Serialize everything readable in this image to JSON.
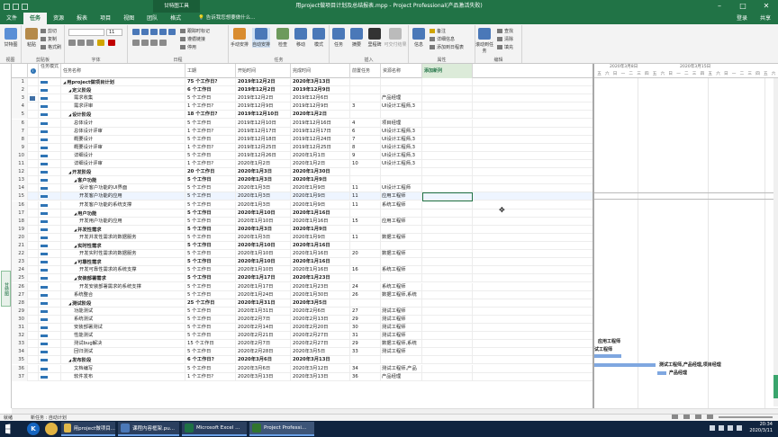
{
  "window": {
    "context_tab": "甘特图工具",
    "title": "用project做项目计划及总结报表.mpp - Project Professional(产品激活失败)",
    "sign_in": "登录",
    "share": "共享"
  },
  "tabs": [
    "文件",
    "任务",
    "资源",
    "报表",
    "项目",
    "视图",
    "团队",
    "格式"
  ],
  "active_tab": "任务",
  "tell_me": "告诉我您想要做什么...",
  "ribbon": {
    "groups": [
      "视图",
      "剪贴板",
      "字体",
      "日程",
      "任务",
      "插入",
      "属性",
      "编辑"
    ],
    "gantt_chart": "甘特图",
    "paste": "粘贴",
    "cut": "剪切",
    "copy": "复制",
    "format_painter": "格式刷",
    "font_size": "11",
    "mark_on_track": "跟踪时标记",
    "respect_links": "遵循链接",
    "inactivate": "停用",
    "manual_schedule": "手动安排",
    "auto_schedule": "自动安排",
    "inspect": "检查",
    "move": "移动",
    "mode": "模式",
    "task": "任务",
    "summary": "摘要",
    "milestone": "里程碑",
    "deliverable": "可交付结果",
    "information": "信息",
    "notes": "备注",
    "details": "详细信息",
    "add_to_timeline": "添加到日程表",
    "scroll_to_task": "滚动到任务",
    "find": "查找",
    "clear": "清除",
    "fill": "填充"
  },
  "side_label": "甘特图",
  "columns": {
    "mode": "任务模式",
    "name": "任务名称",
    "duration": "工期",
    "start": "开始时间",
    "finish": "完成时间",
    "predecessors": "前置任务",
    "resources": "资源名称",
    "add_column": "添加新列"
  },
  "tasks": [
    {
      "id": "1",
      "level": 0,
      "summary": true,
      "name": "用project做项目计划",
      "duration": "75 个工作日?",
      "start": "2019年12月2日",
      "finish": "2020年3月13日",
      "pred": "",
      "res": ""
    },
    {
      "id": "2",
      "level": 1,
      "summary": true,
      "name": "定义阶段",
      "duration": "6 个工作日",
      "start": "2019年12月2日",
      "finish": "2019年12月9日",
      "pred": "",
      "res": ""
    },
    {
      "id": "3",
      "level": 2,
      "summary": false,
      "name": "需求收集",
      "duration": "5 个工作日",
      "start": "2019年12月2日",
      "finish": "2019年12月6日",
      "pred": "",
      "res": "产品经理"
    },
    {
      "id": "4",
      "level": 2,
      "summary": false,
      "name": "需求评审",
      "duration": "1 个工作日?",
      "start": "2019年12月9日",
      "finish": "2019年12月9日",
      "pred": "3",
      "res": "UI设计工程师,3"
    },
    {
      "id": "5",
      "level": 1,
      "summary": true,
      "name": "设计阶段",
      "duration": "18 个工作日?",
      "start": "2019年12月10日",
      "finish": "2020年1月2日",
      "pred": "",
      "res": ""
    },
    {
      "id": "6",
      "level": 2,
      "summary": false,
      "name": "总体设计",
      "duration": "5 个工作日",
      "start": "2019年12月10日",
      "finish": "2019年12月16日",
      "pred": "4",
      "res": "项目经理"
    },
    {
      "id": "7",
      "level": 2,
      "summary": false,
      "name": "总体设计评审",
      "duration": "1 个工作日?",
      "start": "2019年12月17日",
      "finish": "2019年12月17日",
      "pred": "6",
      "res": "UI设计工程师,3"
    },
    {
      "id": "8",
      "level": 2,
      "summary": false,
      "name": "概要设计",
      "duration": "5 个工作日",
      "start": "2019年12月18日",
      "finish": "2019年12月24日",
      "pred": "7",
      "res": "UI设计工程师,3"
    },
    {
      "id": "9",
      "level": 2,
      "summary": false,
      "name": "概要设计评审",
      "duration": "1 个工作日?",
      "start": "2019年12月25日",
      "finish": "2019年12月25日",
      "pred": "8",
      "res": "UI设计工程师,3"
    },
    {
      "id": "10",
      "level": 2,
      "summary": false,
      "name": "详细设计",
      "duration": "5 个工作日",
      "start": "2019年12月26日",
      "finish": "2020年1月1日",
      "pred": "9",
      "res": "UI设计工程师,3"
    },
    {
      "id": "11",
      "level": 2,
      "summary": false,
      "name": "详细设计评审",
      "duration": "1 个工作日?",
      "start": "2020年1月2日",
      "finish": "2020年1月2日",
      "pred": "10",
      "res": "UI设计工程师,3"
    },
    {
      "id": "12",
      "level": 1,
      "summary": true,
      "name": "开发阶段",
      "duration": "20 个工作日",
      "start": "2020年1月3日",
      "finish": "2020年1月30日",
      "pred": "",
      "res": ""
    },
    {
      "id": "13",
      "level": 2,
      "summary": true,
      "name": "客户功能",
      "duration": "5 个工作日",
      "start": "2020年1月3日",
      "finish": "2020年1月9日",
      "pred": "",
      "res": ""
    },
    {
      "id": "14",
      "level": 3,
      "summary": false,
      "name": "设计客户功能的UI界面",
      "duration": "5 个工作日",
      "start": "2020年1月3日",
      "finish": "2020年1月9日",
      "pred": "11",
      "res": "UI设计工程师"
    },
    {
      "id": "15",
      "level": 3,
      "summary": false,
      "name": "开发客户功能的应用",
      "duration": "5 个工作日",
      "start": "2020年1月3日",
      "finish": "2020年1月9日",
      "pred": "11",
      "res": "应用工程师"
    },
    {
      "id": "16",
      "level": 3,
      "summary": false,
      "name": "开发客户功能的系统支撑",
      "duration": "5 个工作日",
      "start": "2020年1月3日",
      "finish": "2020年1月9日",
      "pred": "11",
      "res": "系统工程师"
    },
    {
      "id": "17",
      "level": 2,
      "summary": true,
      "name": "用户功能",
      "duration": "5 个工作日",
      "start": "2020年1月10日",
      "finish": "2020年1月16日",
      "pred": "",
      "res": ""
    },
    {
      "id": "18",
      "level": 3,
      "summary": false,
      "name": "开发用户功能的应用",
      "duration": "5 个工作日",
      "start": "2020年1月10日",
      "finish": "2020年1月16日",
      "pred": "15",
      "res": "应用工程师"
    },
    {
      "id": "19",
      "level": 2,
      "summary": true,
      "name": "并发性需求",
      "duration": "5 个工作日",
      "start": "2020年1月3日",
      "finish": "2020年1月9日",
      "pred": "",
      "res": ""
    },
    {
      "id": "20",
      "level": 3,
      "summary": false,
      "name": "开发并发性需求的数据服务",
      "duration": "5 个工作日",
      "start": "2020年1月3日",
      "finish": "2020年1月9日",
      "pred": "11",
      "res": "数据工程师"
    },
    {
      "id": "21",
      "level": 2,
      "summary": true,
      "name": "实时性需求",
      "duration": "5 个工作日",
      "start": "2020年1月10日",
      "finish": "2020年1月16日",
      "pred": "",
      "res": ""
    },
    {
      "id": "22",
      "level": 3,
      "summary": false,
      "name": "开发实时性需求的数据服务",
      "duration": "5 个工作日",
      "start": "2020年1月10日",
      "finish": "2020年1月16日",
      "pred": "20",
      "res": "数据工程师"
    },
    {
      "id": "23",
      "level": 2,
      "summary": true,
      "name": "可靠性需求",
      "duration": "5 个工作日",
      "start": "2020年1月10日",
      "finish": "2020年1月16日",
      "pred": "",
      "res": ""
    },
    {
      "id": "24",
      "level": 3,
      "summary": false,
      "name": "开发可靠性需求的系统支撑",
      "duration": "5 个工作日",
      "start": "2020年1月10日",
      "finish": "2020年1月16日",
      "pred": "16",
      "res": "系统工程师"
    },
    {
      "id": "25",
      "level": 2,
      "summary": true,
      "name": "安装部署需求",
      "duration": "5 个工作日",
      "start": "2020年1月17日",
      "finish": "2020年1月23日",
      "pred": "",
      "res": ""
    },
    {
      "id": "26",
      "level": 3,
      "summary": false,
      "name": "开发安装部署需求的系统支撑",
      "duration": "5 个工作日",
      "start": "2020年1月17日",
      "finish": "2020年1月23日",
      "pred": "24",
      "res": "系统工程师"
    },
    {
      "id": "27",
      "level": 2,
      "summary": false,
      "name": "系统整合",
      "duration": "5 个工作日",
      "start": "2020年1月24日",
      "finish": "2020年1月30日",
      "pred": "26",
      "res": "数据工程师,系统"
    },
    {
      "id": "28",
      "level": 1,
      "summary": true,
      "name": "测试阶段",
      "duration": "25 个工作日",
      "start": "2020年1月31日",
      "finish": "2020年3月5日",
      "pred": "",
      "res": ""
    },
    {
      "id": "29",
      "level": 2,
      "summary": false,
      "name": "功能测试",
      "duration": "5 个工作日",
      "start": "2020年1月31日",
      "finish": "2020年2月6日",
      "pred": "27",
      "res": "测试工程师"
    },
    {
      "id": "30",
      "level": 2,
      "summary": false,
      "name": "系统测试",
      "duration": "5 个工作日",
      "start": "2020年2月7日",
      "finish": "2020年2月13日",
      "pred": "29",
      "res": "测试工程师"
    },
    {
      "id": "31",
      "level": 2,
      "summary": false,
      "name": "安装部署测试",
      "duration": "5 个工作日",
      "start": "2020年2月14日",
      "finish": "2020年2月20日",
      "pred": "30",
      "res": "测试工程师"
    },
    {
      "id": "32",
      "level": 2,
      "summary": false,
      "name": "性能测试",
      "duration": "5 个工作日",
      "start": "2020年2月21日",
      "finish": "2020年2月27日",
      "pred": "31",
      "res": "测试工程师"
    },
    {
      "id": "33",
      "level": 2,
      "summary": false,
      "name": "测试bug解决",
      "duration": "15 个工作日",
      "start": "2020年2月7日",
      "finish": "2020年2月27日",
      "pred": "29",
      "res": "数据工程师,系统"
    },
    {
      "id": "34",
      "level": 2,
      "summary": false,
      "name": "回归测试",
      "duration": "5 个工作日",
      "start": "2020年2月28日",
      "finish": "2020年3月5日",
      "pred": "33",
      "res": "测试工程师"
    },
    {
      "id": "35",
      "level": 1,
      "summary": true,
      "name": "发布阶段",
      "duration": "6 个工作日?",
      "start": "2020年3月6日",
      "finish": "2020年3月13日",
      "pred": "",
      "res": ""
    },
    {
      "id": "36",
      "level": 2,
      "summary": false,
      "name": "文档编写",
      "duration": "5 个工作日",
      "start": "2020年3月6日",
      "finish": "2020年3月12日",
      "pred": "34",
      "res": "测试工程师,产品"
    },
    {
      "id": "37",
      "level": 2,
      "summary": false,
      "name": "软件发布",
      "duration": "1 个工作日?",
      "start": "2020年3月13日",
      "finish": "2020年3月13日",
      "pred": "36",
      "res": "产品经理"
    }
  ],
  "selected_row": "15",
  "gantt": {
    "tier1": [
      "2020年3月8日",
      "2020年3月15日"
    ],
    "tier2": [
      "五",
      "六",
      "日",
      "一",
      "二",
      "三",
      "四",
      "五",
      "六",
      "日",
      "一",
      "二",
      "三",
      "四",
      "五",
      "六",
      "日",
      "一",
      "二",
      "三",
      "四",
      "五",
      "六"
    ],
    "labels": {
      "row32": "应用工程师",
      "row33": "试工程师",
      "row36": "测试工程师,产品经理,项目经理",
      "row37": "产品经理"
    }
  },
  "status": {
    "ready": "就绪",
    "new_tasks": "新任务 : 自动计划"
  },
  "taskbar": {
    "items": [
      {
        "label": "用project做项目...",
        "color": "#e0b84a"
      },
      {
        "label": "课程内容框架.pu...",
        "color": "#4a78b8"
      },
      {
        "label": "Microsoft Excel ...",
        "color": "#1e7145"
      },
      {
        "label": "Project Professi...",
        "color": "#31752f"
      }
    ],
    "time": "20:34",
    "date": "2020/3/11"
  }
}
